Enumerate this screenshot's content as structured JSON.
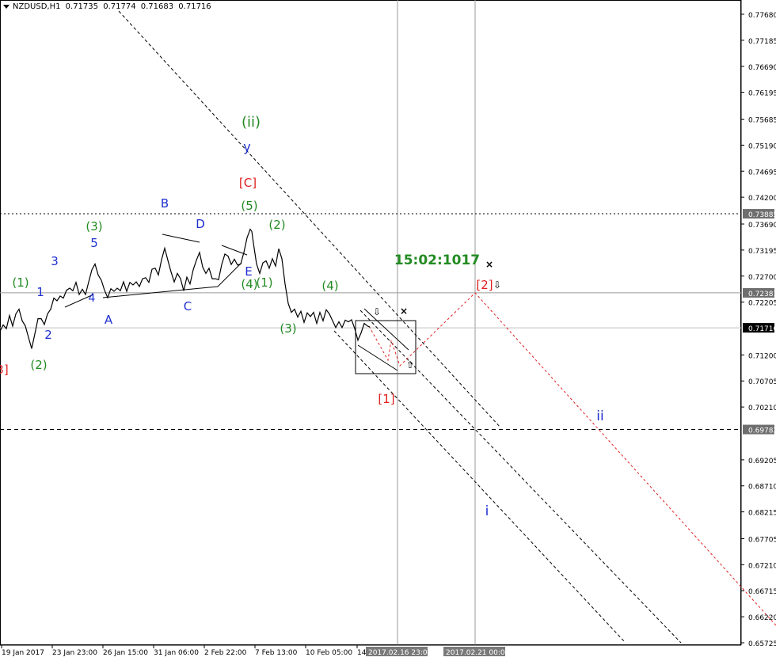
{
  "header": {
    "symbol": "NZDUSD,H1",
    "open": "0.71735",
    "high": "0.71774",
    "low": "0.71683",
    "close": "0.71716"
  },
  "timer": "15:02:1017",
  "chart_data": {
    "type": "line",
    "symbol": "NZDUSD",
    "timeframe": "H1",
    "ylim": [
      0.65725,
      0.77925
    ],
    "y_ticks": [
      0.7768,
      0.77185,
      0.7669,
      0.76195,
      0.75685,
      0.7519,
      0.74695,
      0.742,
      0.7369,
      0.73195,
      0.727,
      0.72205,
      0.712,
      0.70705,
      0.7021,
      0.69205,
      0.6871,
      0.68215,
      0.67705,
      0.6721,
      0.66715,
      0.6622,
      0.65725
    ],
    "y_tick_labels": [
      "0.77680",
      "0.77185",
      "0.76690",
      "0.76195",
      "0.75685",
      "0.75190",
      "0.74695",
      "0.74200",
      "0.73690",
      "0.73195",
      "0.72700",
      "0.72205",
      "0.71200",
      "0.70705",
      "0.70210",
      "0.69205",
      "0.68710",
      "0.68215",
      "0.67705",
      "0.67210",
      "0.66715",
      "0.66220",
      "0.65725"
    ],
    "x_ticks": [
      "19 Jan 2017",
      "23 Jan 23:00",
      "26 Jan 15:00",
      "31 Jan 06:00",
      "2 Feb 22:00",
      "7 Feb 13:00",
      "10 Feb 05:00",
      "14"
    ],
    "x_markers": [
      "2017.02.16 23:00",
      "2017.02.21 00:00"
    ],
    "price_levels": [
      {
        "value": 0.73885,
        "label": "0.73885",
        "style": "dotted",
        "color": "#000000"
      },
      {
        "value": 0.72381,
        "label": "0.72381",
        "style": "solid",
        "color": "#9a9a9a"
      },
      {
        "value": 0.71716,
        "label": "0.71716",
        "style": "solid",
        "color": "#c0c0c0",
        "current": true
      },
      {
        "value": 0.69782,
        "label": "0.69782",
        "style": "dashed",
        "color": "#000000"
      }
    ],
    "price_series": [
      [
        0,
        0.7162
      ],
      [
        4,
        0.718
      ],
      [
        8,
        0.717
      ],
      [
        12,
        0.7192
      ],
      [
        16,
        0.7178
      ],
      [
        20,
        0.7198
      ],
      [
        24,
        0.7204
      ],
      [
        28,
        0.7188
      ],
      [
        32,
        0.7175
      ],
      [
        36,
        0.715
      ],
      [
        40,
        0.7135
      ],
      [
        44,
        0.716
      ],
      [
        48,
        0.7186
      ],
      [
        52,
        0.7192
      ],
      [
        56,
        0.7178
      ],
      [
        60,
        0.7195
      ],
      [
        64,
        0.721
      ],
      [
        68,
        0.7228
      ],
      [
        72,
        0.722
      ],
      [
        76,
        0.7235
      ],
      [
        80,
        0.7228
      ],
      [
        84,
        0.724
      ],
      [
        88,
        0.725
      ],
      [
        92,
        0.7242
      ],
      [
        96,
        0.7255
      ],
      [
        100,
        0.7238
      ],
      [
        104,
        0.7245
      ],
      [
        108,
        0.7232
      ],
      [
        112,
        0.7262
      ],
      [
        116,
        0.7282
      ],
      [
        120,
        0.729
      ],
      [
        124,
        0.7275
      ],
      [
        128,
        0.7262
      ],
      [
        132,
        0.724
      ],
      [
        136,
        0.7232
      ],
      [
        140,
        0.7246
      ],
      [
        144,
        0.7238
      ],
      [
        148,
        0.725
      ],
      [
        152,
        0.7242
      ],
      [
        156,
        0.7256
      ],
      [
        160,
        0.7244
      ],
      [
        164,
        0.7258
      ],
      [
        168,
        0.725
      ],
      [
        172,
        0.7262
      ],
      [
        176,
        0.725
      ],
      [
        180,
        0.7262
      ],
      [
        184,
        0.727
      ],
      [
        188,
        0.7258
      ],
      [
        192,
        0.728
      ],
      [
        196,
        0.7288
      ],
      [
        200,
        0.7272
      ],
      [
        204,
        0.7298
      ],
      [
        208,
        0.7326
      ],
      [
        212,
        0.73
      ],
      [
        216,
        0.7275
      ],
      [
        220,
        0.7262
      ],
      [
        224,
        0.7275
      ],
      [
        228,
        0.7262
      ],
      [
        232,
        0.7245
      ],
      [
        236,
        0.7268
      ],
      [
        240,
        0.7252
      ],
      [
        244,
        0.7285
      ],
      [
        248,
        0.73
      ],
      [
        252,
        0.7312
      ],
      [
        256,
        0.729
      ],
      [
        260,
        0.7275
      ],
      [
        264,
        0.7282
      ],
      [
        268,
        0.7268
      ],
      [
        272,
        0.7265
      ],
      [
        276,
        0.726
      ],
      [
        280,
        0.7295
      ],
      [
        284,
        0.7312
      ],
      [
        288,
        0.7305
      ],
      [
        292,
        0.7295
      ],
      [
        296,
        0.7302
      ],
      [
        300,
        0.7288
      ],
      [
        304,
        0.7296
      ],
      [
        308,
        0.7315
      ],
      [
        312,
        0.734
      ],
      [
        316,
        0.7362
      ],
      [
        318,
        0.7355
      ],
      [
        320,
        0.733
      ],
      [
        324,
        0.7296
      ],
      [
        328,
        0.7275
      ],
      [
        332,
        0.7292
      ],
      [
        336,
        0.7302
      ],
      [
        340,
        0.7285
      ],
      [
        344,
        0.73
      ],
      [
        348,
        0.7292
      ],
      [
        352,
        0.7322
      ],
      [
        356,
        0.73
      ],
      [
        360,
        0.7258
      ],
      [
        364,
        0.7218
      ],
      [
        368,
        0.7198
      ],
      [
        372,
        0.721
      ],
      [
        376,
        0.7192
      ],
      [
        380,
        0.72
      ],
      [
        384,
        0.7185
      ],
      [
        388,
        0.72
      ],
      [
        392,
        0.719
      ],
      [
        396,
        0.7204
      ],
      [
        400,
        0.718
      ],
      [
        404,
        0.7198
      ],
      [
        408,
        0.7188
      ],
      [
        412,
        0.7206
      ],
      [
        416,
        0.7195
      ],
      [
        420,
        0.7188
      ],
      [
        424,
        0.7172
      ],
      [
        428,
        0.718
      ],
      [
        432,
        0.7175
      ],
      [
        436,
        0.7186
      ],
      [
        440,
        0.718
      ],
      [
        444,
        0.719
      ],
      [
        448,
        0.717
      ],
      [
        452,
        0.7145
      ],
      [
        456,
        0.7165
      ],
      [
        460,
        0.718
      ],
      [
        464,
        0.7172
      ],
      [
        467,
        0.7176
      ]
    ],
    "annotations": [
      {
        "text": "(ii)",
        "color": "#228b22"
      },
      {
        "text": "y",
        "color": "#1f2fd0"
      },
      {
        "text": "[C]",
        "color": "#e02020"
      },
      {
        "text": "(5)",
        "color": "#228b22"
      },
      {
        "text": "(2)",
        "color": "#228b22"
      },
      {
        "text": "B",
        "color": "#1f2fd0"
      },
      {
        "text": "D",
        "color": "#1f2fd0"
      },
      {
        "text": "(3)",
        "color": "#228b22"
      },
      {
        "text": "5",
        "color": "#1f2fd0"
      },
      {
        "text": "3",
        "color": "#1f2fd0"
      },
      {
        "text": "(1)",
        "color": "#228b22"
      },
      {
        "text": "1",
        "color": "#1f2fd0"
      },
      {
        "text": "4",
        "color": "#1f2fd0"
      },
      {
        "text": "A",
        "color": "#1f2fd0"
      },
      {
        "text": "C",
        "color": "#1f2fd0"
      },
      {
        "text": "E",
        "color": "#1f2fd0"
      },
      {
        "text": "(4)",
        "color": "#228b22"
      },
      {
        "text": "(1)",
        "color": "#228b22"
      },
      {
        "text": "(4)",
        "color": "#228b22"
      },
      {
        "text": "(3)",
        "color": "#228b22"
      },
      {
        "text": "2",
        "color": "#1f2fd0"
      },
      {
        "text": "(2)",
        "color": "#228b22"
      },
      {
        "text": "3]",
        "color": "#e02020"
      },
      {
        "text": "[1]",
        "color": "#e02020"
      },
      {
        "text": "[2]",
        "color": "#e02020"
      },
      {
        "text": "ii",
        "color": "#1f2fd0"
      },
      {
        "text": "i",
        "color": "#1f2fd0"
      }
    ]
  }
}
